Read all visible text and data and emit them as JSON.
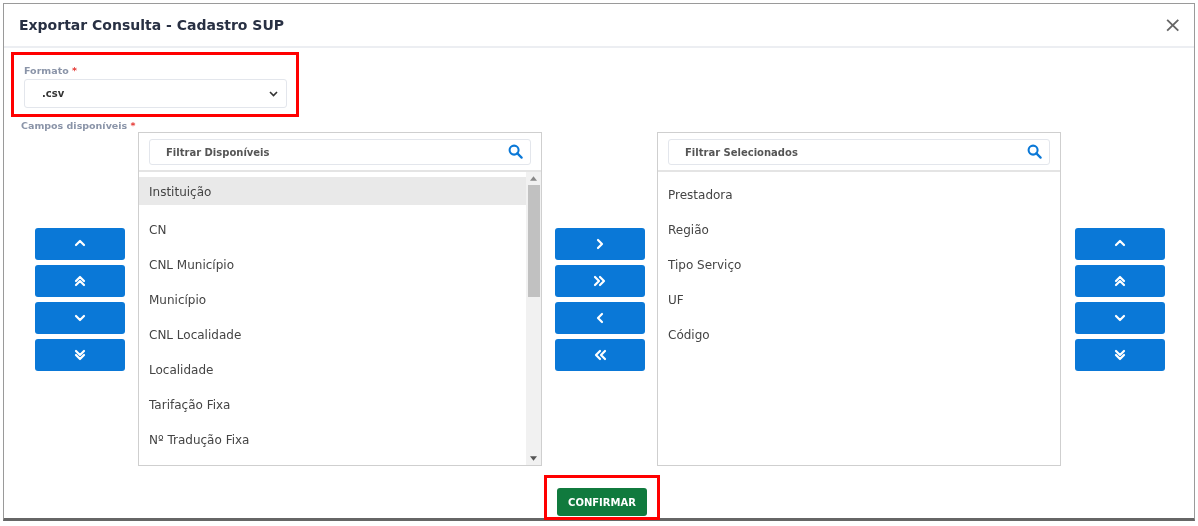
{
  "dialog": {
    "title": "Exportar Consulta - Cadastro SUP",
    "close": "×"
  },
  "format": {
    "label": "Formato",
    "required": "*",
    "value": ".csv",
    "highlighted": true
  },
  "fields": {
    "label": "Campos disponíveis",
    "required": "*"
  },
  "available": {
    "placeholder": "Filtrar Disponíveis",
    "items": [
      {
        "label": "Instituição",
        "selected": true
      },
      {
        "label": "CN",
        "selected": false
      },
      {
        "label": "CNL Município",
        "selected": false
      },
      {
        "label": "Município",
        "selected": false
      },
      {
        "label": "CNL Localidade",
        "selected": false
      },
      {
        "label": "Localidade",
        "selected": false
      },
      {
        "label": "Tarifação Fixa",
        "selected": false
      },
      {
        "label": "Nº Tradução Fixa",
        "selected": false
      }
    ]
  },
  "left_buttons": [
    {
      "kind": "up"
    },
    {
      "kind": "top"
    },
    {
      "kind": "down"
    },
    {
      "kind": "bottom"
    }
  ],
  "move_buttons": [
    {
      "kind": "right"
    },
    {
      "kind": "all-right"
    },
    {
      "kind": "left"
    },
    {
      "kind": "all-left"
    }
  ],
  "chosen": {
    "placeholder": "Filtrar Selecionados",
    "items": [
      {
        "label": "Prestadora",
        "selected": false
      },
      {
        "label": "Região",
        "selected": false
      },
      {
        "label": "Tipo Serviço",
        "selected": false
      },
      {
        "label": "UF",
        "selected": false
      },
      {
        "label": "Código",
        "selected": false
      }
    ]
  },
  "right_buttons": [
    {
      "kind": "up"
    },
    {
      "kind": "top"
    },
    {
      "kind": "down"
    },
    {
      "kind": "bottom"
    }
  ],
  "confirm": {
    "label": "CONFIRMAR",
    "highlighted": true
  }
}
